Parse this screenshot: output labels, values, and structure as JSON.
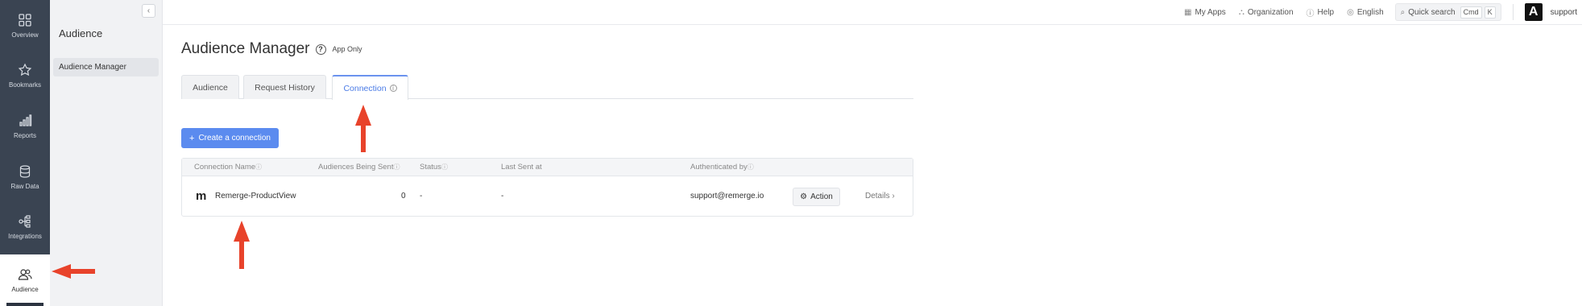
{
  "rail": {
    "items": [
      {
        "label": "Overview",
        "icon": "grid-icon"
      },
      {
        "label": "Bookmarks",
        "icon": "star-icon"
      },
      {
        "label": "Reports",
        "icon": "bar-chart-icon"
      },
      {
        "label": "Raw Data",
        "icon": "database-icon"
      },
      {
        "label": "Integrations",
        "icon": "integrations-icon"
      },
      {
        "label": "Audience",
        "icon": "users-icon",
        "active": true
      }
    ]
  },
  "subnav": {
    "title": "Audience",
    "items": [
      {
        "label": "Audience Manager",
        "selected": true
      }
    ],
    "collapse_icon": "‹"
  },
  "topbar": {
    "my_apps": "My Apps",
    "organization": "Organization",
    "help": "Help",
    "language": "English",
    "search_label": "Quick search",
    "search_kbd_1": "Cmd",
    "search_kbd_2": "K",
    "avatar_letter": "A",
    "user": "support"
  },
  "page": {
    "title": "Audience Manager",
    "badge": "App Only"
  },
  "tabs": [
    {
      "label": "Audience"
    },
    {
      "label": "Request History"
    },
    {
      "label": "Connection",
      "active": true
    }
  ],
  "create_button": "Create a connection",
  "table": {
    "columns": [
      "Connection Name",
      "Audiences Being Sent",
      "Status",
      "Last Sent at",
      "Authenticated by"
    ],
    "rows": [
      {
        "logo": "m",
        "name": "Remerge-ProductView",
        "audiences": "0",
        "status": "-",
        "last_sent": "-",
        "authenticated_by": "support@remerge.io",
        "action": "Action",
        "details": "Details"
      }
    ]
  },
  "colors": {
    "rail_bg": "#3a4452",
    "accent": "#5b8bef",
    "annotation_arrow": "#e8432b"
  }
}
